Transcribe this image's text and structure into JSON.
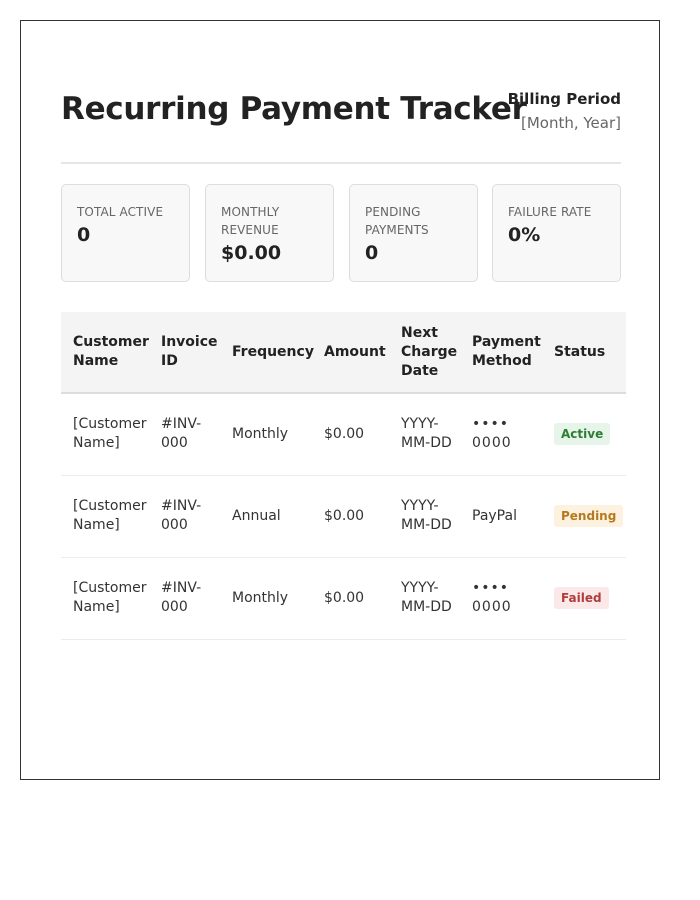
{
  "header": {
    "title": "Recurring Payment Tracker",
    "billing_label": "Billing Period",
    "billing_value": "[Month, Year]"
  },
  "summary_cards": [
    {
      "label": "Total Active",
      "value": "0"
    },
    {
      "label": "Monthly Revenue",
      "value": "$0.00"
    },
    {
      "label": "Pending Payments",
      "value": "0"
    },
    {
      "label": "Failure Rate",
      "value": "0%"
    }
  ],
  "table": {
    "columns": [
      "Customer Name",
      "Invoice ID",
      "Frequency",
      "Amount",
      "Next Charge Date",
      "Payment Method",
      "Status"
    ],
    "rows": [
      {
        "customer": "[Customer Name]",
        "invoice": "#INV-000",
        "frequency": "Monthly",
        "amount": "$0.00",
        "next_charge": "YYYY-MM-DD",
        "method": "•••• 0000",
        "status": "Active"
      },
      {
        "customer": "[Customer Name]",
        "invoice": "#INV-000",
        "frequency": "Annual",
        "amount": "$0.00",
        "next_charge": "YYYY-MM-DD",
        "method": "PayPal",
        "status": "Pending"
      },
      {
        "customer": "[Customer Name]",
        "invoice": "#INV-000",
        "frequency": "Monthly",
        "amount": "$0.00",
        "next_charge": "YYYY-MM-DD",
        "method": "•••• 0000",
        "status": "Failed"
      }
    ]
  },
  "colors": {
    "active_bg": "#e6f4ea",
    "active_text": "#2e7d32",
    "pending_bg": "#fdf1e0",
    "pending_text": "#b7791f",
    "failed_bg": "#fbe9ea",
    "failed_text": "#b23b3b"
  }
}
